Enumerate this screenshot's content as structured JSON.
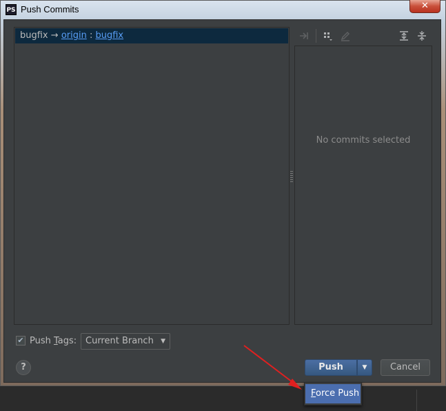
{
  "window": {
    "icon_text": "PS",
    "title": "Push Commits",
    "close_glyph": "✕"
  },
  "branch": {
    "local": "bugfix",
    "arrow": "→",
    "remote": "origin",
    "separator": ":",
    "remote_branch": "bugfix"
  },
  "details": {
    "empty_text": "No commits selected"
  },
  "toolbar": {
    "icons": [
      "merge-icon",
      "group-icon",
      "edit-icon",
      "expand-all-icon",
      "collapse-all-icon"
    ]
  },
  "footer": {
    "push_tags_checked": true,
    "push_tags_label_pre": "Push ",
    "push_tags_label_mnemonic": "T",
    "push_tags_label_post": "ags:",
    "tags_combo_value": "Current Branch",
    "help_label": "?",
    "push_label": "Push",
    "cancel_label": "Cancel"
  },
  "push_menu": {
    "items": [
      {
        "mnemonic": "F",
        "rest": "orce Push"
      }
    ]
  },
  "colors": {
    "dialog_bg": "#3c3f41",
    "selection_bg": "#0d293e",
    "link": "#589df6",
    "primary_button": "#365880",
    "menu_highlight": "#4b6eaf",
    "annotation_arrow": "#e02020"
  }
}
